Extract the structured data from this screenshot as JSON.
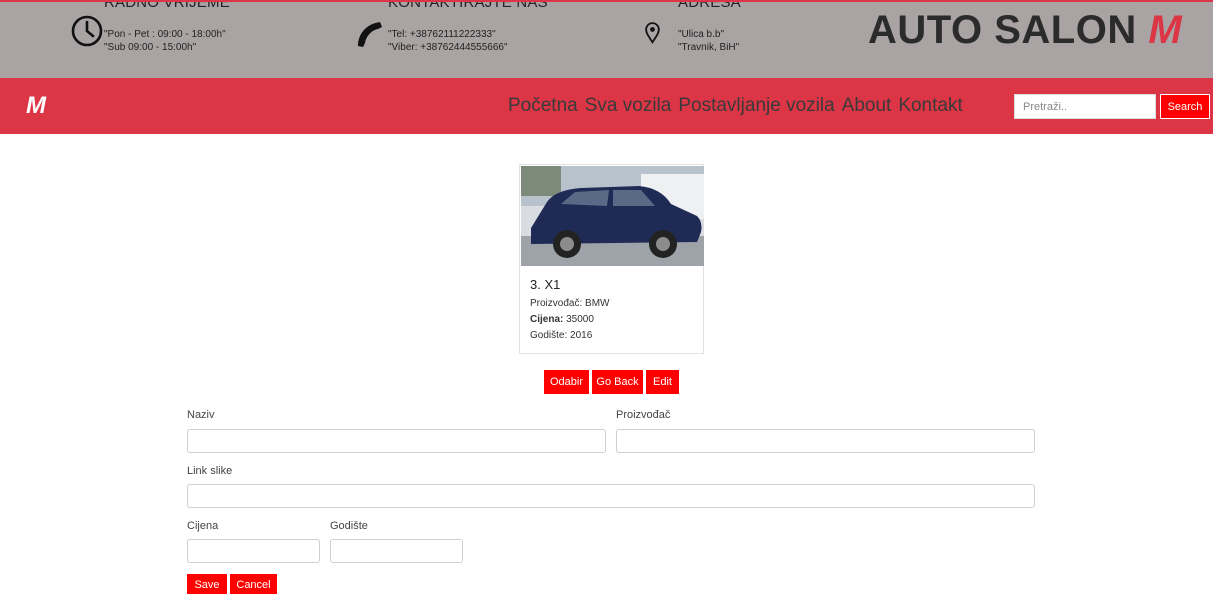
{
  "topbar": {
    "hours": {
      "icon": "clock-icon",
      "title": "RADNO VRIJEME",
      "line1": "\"Pon - Pet : 09:00 - 18:00h\"",
      "line2": "\"Sub 09:00 - 15:00h\""
    },
    "contact": {
      "icon": "phone-icon",
      "title": "KONTAKTIRAJTE NAS",
      "line1": "\"Tel: +38762111222333\"",
      "line2": "\"Viber: +38762444555666\""
    },
    "address": {
      "icon": "location-pin-icon",
      "title": "ADRESA",
      "line1": "\"Ulica b.b\"",
      "line2": "\"Travnik, BiH\""
    },
    "brand": {
      "text": "AUTO SALON",
      "accent": "M"
    }
  },
  "navbar": {
    "logo": "M",
    "links": [
      "Početna",
      "Sva vozila",
      "Postavljanje vozila",
      "About",
      "Kontakt"
    ],
    "search_placeholder": "Pretraži..",
    "search_label": "Search"
  },
  "card": {
    "title": "3. X1",
    "manufacturer_label": "Proizvođač:",
    "manufacturer": "BMW",
    "price_label": "Cijena:",
    "price": "35000",
    "year_label": "Godište:",
    "year": "2016"
  },
  "actions": {
    "select": "Odabir",
    "back": "Go Back",
    "edit": "Edit"
  },
  "form": {
    "name_label": "Naziv",
    "manufacturer_label": "Proizvođač",
    "image_link_label": "Link slike",
    "price_label": "Cijena",
    "year_label": "Godište",
    "save": "Save",
    "cancel": "Cancel"
  },
  "colors": {
    "accent": "#dc3545",
    "button": "#ff0000",
    "topbar": "#a9a3a3"
  }
}
